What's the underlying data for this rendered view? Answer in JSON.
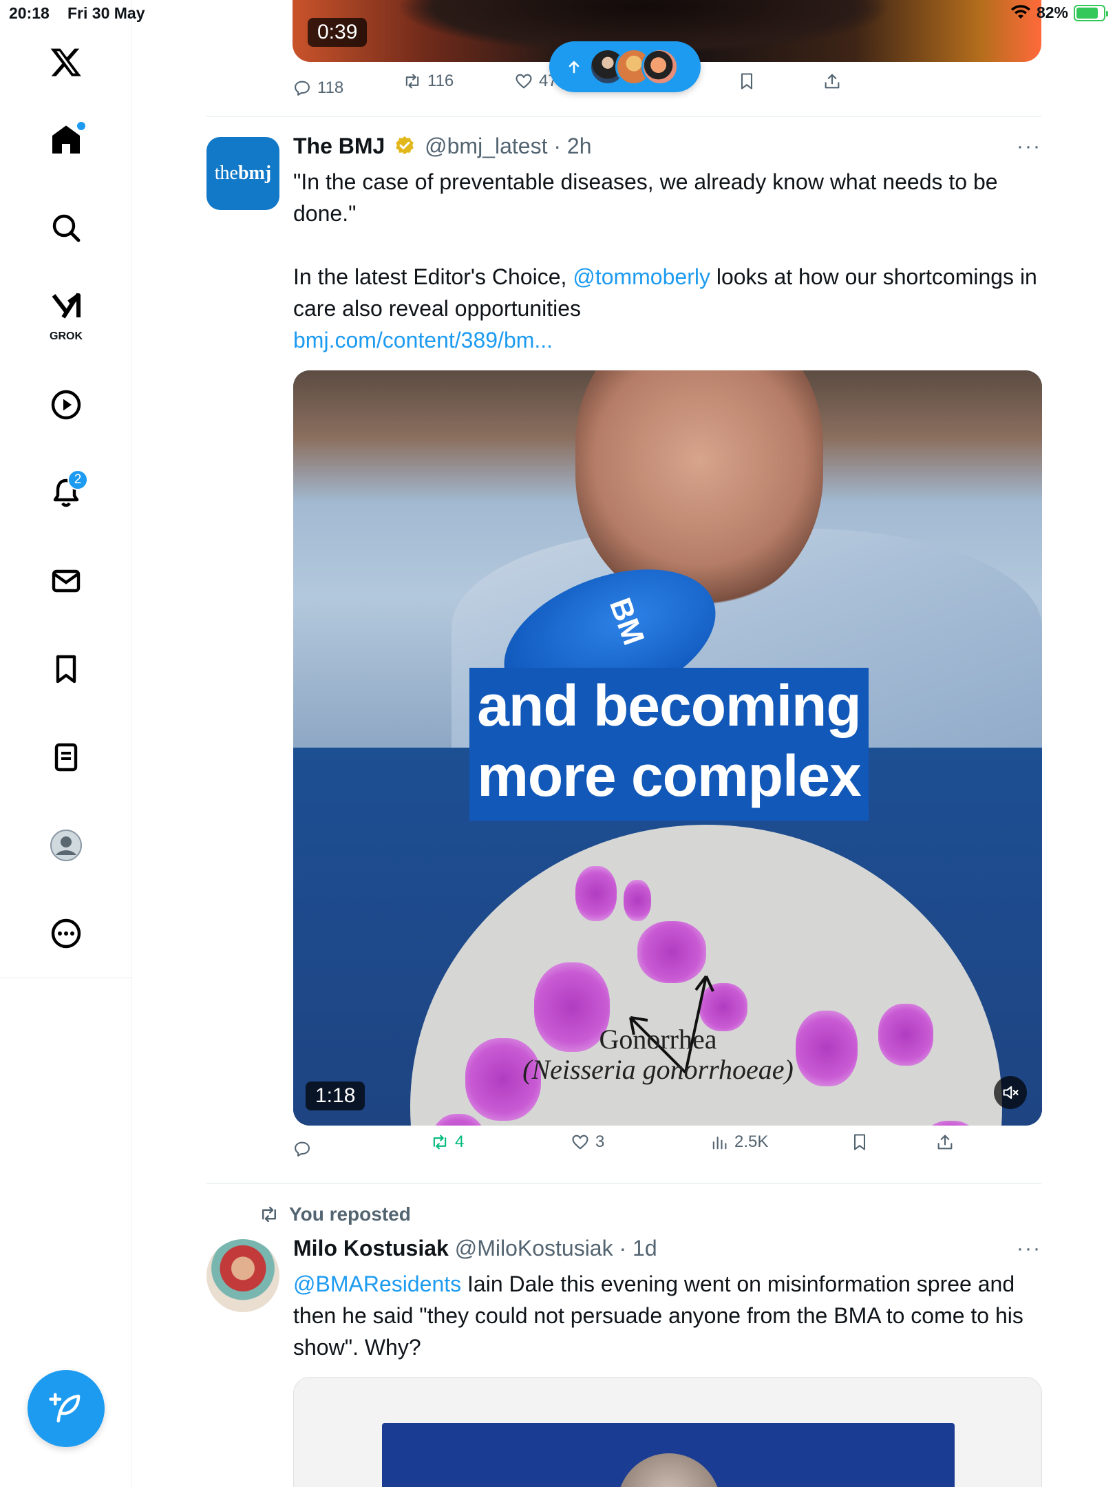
{
  "status_bar": {
    "time": "20:18",
    "date": "Fri 30 May",
    "battery": "82%",
    "battery_level": 0.82
  },
  "sidebar": {
    "items": [
      {
        "name": "x-logo"
      },
      {
        "name": "home"
      },
      {
        "name": "search"
      },
      {
        "name": "grok",
        "label": "GROK"
      },
      {
        "name": "video"
      },
      {
        "name": "notifications",
        "badge": "2"
      },
      {
        "name": "messages"
      },
      {
        "name": "bookmarks"
      },
      {
        "name": "lists"
      },
      {
        "name": "profile"
      },
      {
        "name": "more"
      }
    ]
  },
  "top_tweet": {
    "video_duration": "0:39",
    "replies": "118",
    "reposts": "116",
    "likes": "47"
  },
  "bmj_tweet": {
    "avatar_text_regular": "the",
    "avatar_text_bold": "bmj",
    "name": "The BMJ",
    "handle": "@bmj_latest",
    "time": "· 2h",
    "more": "···",
    "text_line1": "\"In the case of preventable diseases, we already know what needs to be done.\"",
    "text_line2_pre": "In the latest Editor's Choice, ",
    "text_line2_mention": "@tommoberly",
    "text_line2_post": " looks at how our shortcomings in care also reveal opportunities",
    "text_link": "bmj.com/content/389/bm...",
    "video_caption_line1": "and becoming",
    "video_caption_line2": "more complex",
    "mic_text": "BM",
    "slide_label_1": "Gonorrhea",
    "slide_label_2": "(Neisseria gonorrhoeae)",
    "video_duration": "1:18",
    "replies": "",
    "reposts": "4",
    "likes": "3",
    "views": "2.5K"
  },
  "repost_tweet": {
    "repost_label": "You reposted",
    "name": "Milo Kostusiak",
    "handle": "@MiloKostusiak",
    "time": "· 1d",
    "more": "···",
    "mention": "@BMAResidents",
    "text": " Iain Dale this evening went on misinformation spree and then he said \"they could not persuade anyone from the BMA to come to his show\". Why?"
  },
  "colors": {
    "accent": "#1d9bf0",
    "repost_green": "#00ba7c",
    "text_secondary": "#536471"
  }
}
